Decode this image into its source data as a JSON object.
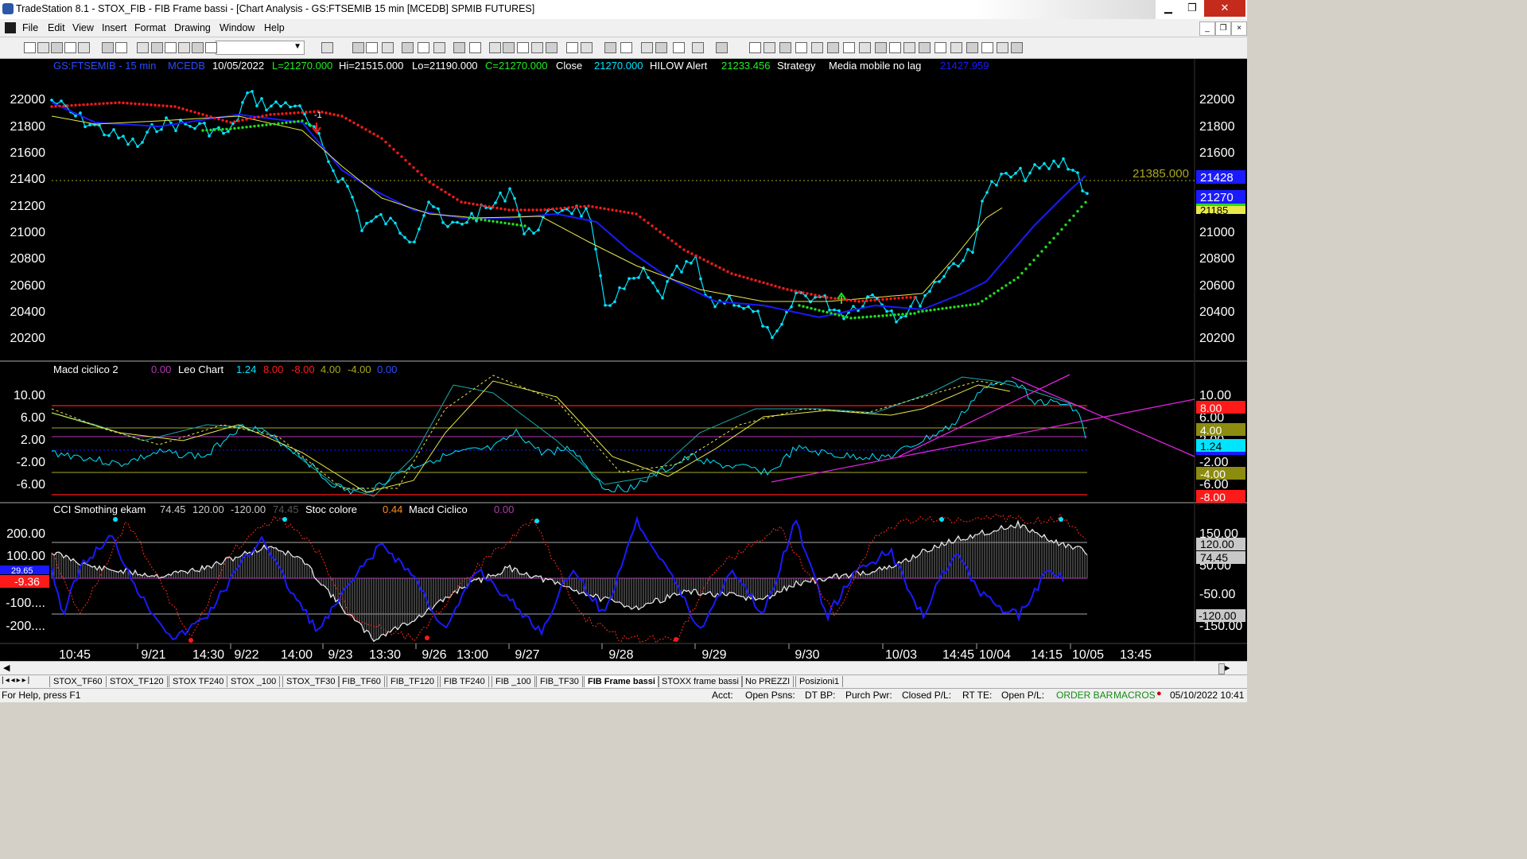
{
  "window": {
    "title": "TradeStation 8.1 - STOX_FIB - FIB Frame bassi - [Chart Analysis - GS:FTSEMIB  15 min  [MCEDB] SPMIB FUTURES]",
    "buttons": {
      "minimize": "▁",
      "maximize": "❐",
      "close": "✕"
    },
    "mdi_buttons": {
      "minimize": "_",
      "restore": "❐",
      "close": "×"
    }
  },
  "menu": [
    "File",
    "Edit",
    "View",
    "Insert",
    "Format",
    "Drawing",
    "Window",
    "Help"
  ],
  "toolbar": {
    "symbol_dropdown": ""
  },
  "price_header": {
    "symbol": "GS:FTSEMIB - 15 min",
    "datasource": "MCEDB",
    "date": "10/05/2022",
    "last": "L=21270.000",
    "high": "Hi=21515.000",
    "low": "Lo=21190.000",
    "close": "C=21270.000",
    "close_label": "Close",
    "close_value": "21270.000",
    "hilow_label": "HILOW Alert",
    "hilow_value": "21233.456",
    "strategy_label": "Strategy",
    "media_label": "Media mobile no lag",
    "media_value": "21427.959"
  },
  "macd_header": {
    "name": "Macd ciclico 2",
    "v1": "0.00",
    "leo": "Leo Chart",
    "v2": "1.24",
    "v3": "8.00",
    "v4": "-8.00",
    "v5": "4.00",
    "v6": "-4.00",
    "v7": "0.00"
  },
  "cci_header": {
    "name": "CCI Smothing ekam",
    "v1": "74.45",
    "v2": "120.00",
    "v3": "-120.00",
    "v4": "74.45",
    "stoc_label": "Stoc colore",
    "stoc_value": "0.44",
    "macd_label": "Macd Ciclico",
    "macd_value": "0.00"
  },
  "axes": {
    "price_ticks": [
      "22000",
      "21800",
      "21600",
      "21400",
      "21200",
      "21000",
      "20800",
      "20600",
      "20400",
      "20200"
    ],
    "macd_ticks": [
      "10.00",
      "6.00",
      "2.00",
      "-2.00",
      "-6.00"
    ],
    "cci_left_ticks": [
      "200.00",
      "100.00",
      "-100....",
      "-200...."
    ],
    "cci_right_ticks": [
      "150.00",
      "50.00",
      "-50.00",
      "-150.00"
    ],
    "time_ticks": [
      "10:45",
      "9/21",
      "14:30",
      "9/22",
      "14:00",
      "9/23",
      "13:30",
      "9/26",
      "13:00",
      "9/27",
      "9/28",
      "9/29",
      "9/30",
      "10/03",
      "14:45",
      "10/04",
      "14:15",
      "10/05",
      "13:45"
    ]
  },
  "markers": {
    "price_line": "21385.000",
    "price_media": "21428",
    "price_last": "21270",
    "price_yellow": "21185",
    "macd_red_top": "8.00",
    "macd_olive": "4.00",
    "macd_cyan": "1.24",
    "macd_olive_neg": "-4.00",
    "macd_red_bot": "-8.00",
    "cci_120": "120.00",
    "cci_74": "74.45",
    "cci_neg120": "-120.00",
    "cci_left_blue": "29.65",
    "cci_left_red": "-9.36",
    "signal_label": "-1"
  },
  "tabs": [
    "STOX_TF60",
    "STOX_TF120",
    "STOX TF240",
    "STOX _100",
    "STOX_TF30",
    "FIB_TF60",
    "FIB_TF120",
    "FIB TF240",
    "FIB _100",
    "FIB_TF30",
    "FIB Frame bassi",
    "STOXX frame bassi",
    "No PREZZI",
    "Posizioni1"
  ],
  "active_tab": "FIB Frame bassi",
  "status": {
    "help": "For Help, press F1",
    "acct": "Acct:",
    "open_psns": "Open Psns:",
    "dt_bp": "DT BP:",
    "purch_pwr": "Purch Pwr:",
    "closed_pl": "Closed P/L:",
    "rt_te": "RT TE:",
    "open_pl": "Open P/L:",
    "order_bar": "ORDER BAR",
    "macros": "MACROS",
    "datetime": "05/10/2022 10:41"
  },
  "colors": {
    "price_bars": "#00e5ff",
    "ma_blue": "#1a1aff",
    "ma_yellow": "#e8e84a",
    "stop_red": "#ff1a1a",
    "stop_green": "#22dd22",
    "trendline": "#dd22dd",
    "label_cyan": "#00e5ff",
    "label_green": "#22ee22",
    "header_blue": "#2a4cff"
  }
}
